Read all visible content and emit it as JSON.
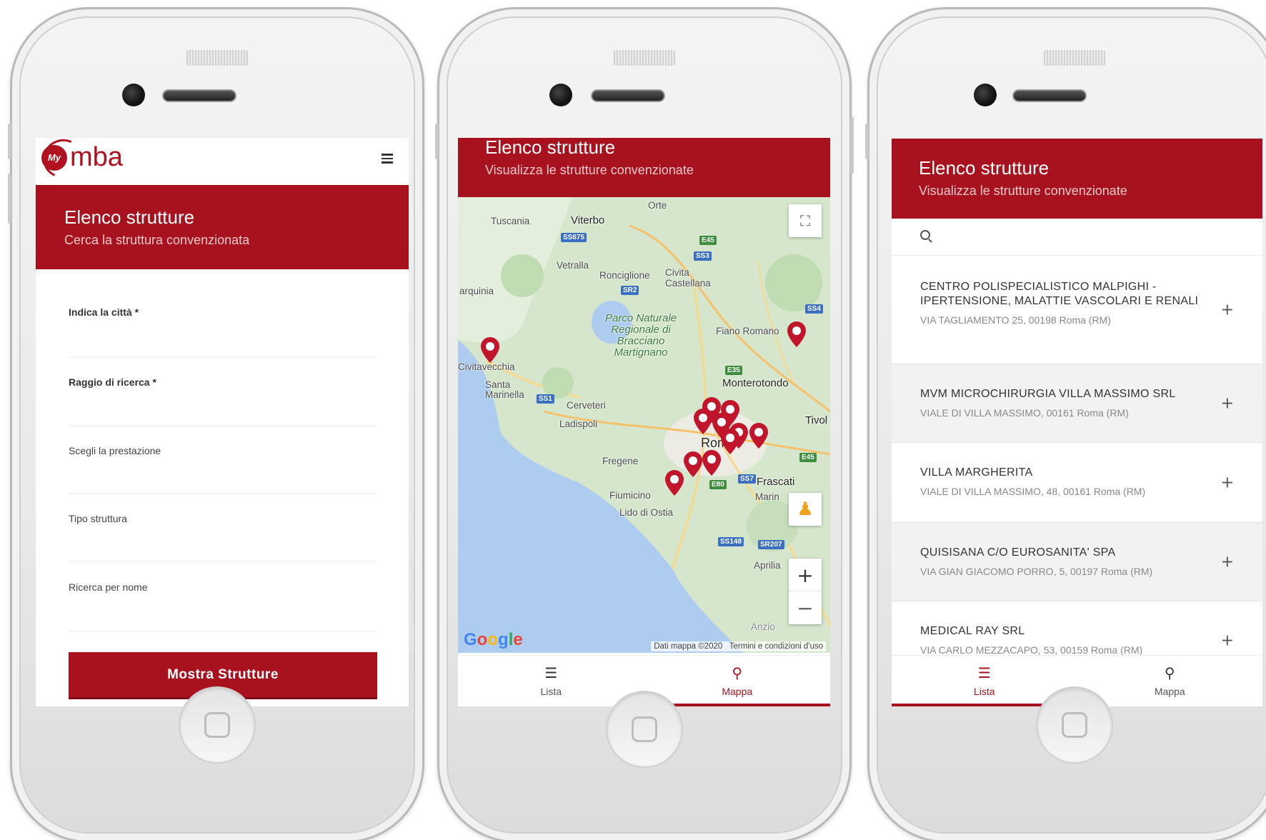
{
  "brand": {
    "logo_badge": "My",
    "logo_word": "mba",
    "accent": "#a8121e"
  },
  "search_form": {
    "title": "Elenco strutture",
    "subtitle": "Cerca la struttura convenzionata",
    "fields": {
      "city_label": "Indica la città *",
      "radius_label": "Raggio di ricerca *",
      "service_label": "Scegli la prestazione",
      "type_label": "Tipo struttura",
      "name_label": "Ricerca per nome"
    },
    "submit_label": "Mostra Strutture"
  },
  "map_view": {
    "title": "Elenco strutture",
    "subtitle": "Visualizza le strutture convenzionate",
    "places": {
      "orte": "Orte",
      "tuscania": "Tuscania",
      "viterbo": "Viterbo",
      "vetralla": "Vetralla",
      "ronciglione": "Ronciglione",
      "civita": "Civita\nCastellana",
      "tarquinia": "arquinia",
      "parco": "Parco Naturale Regionale di Bracciano Martignano",
      "fiano": "Fiano Romano",
      "civitavecchia": "Civitavecchia",
      "santa_marinella": "Santa Marinella",
      "cerveteri": "Cerveteri",
      "ladispoli": "Ladispoli",
      "monterotondo": "Monterotondo",
      "tivoli": "Tivol",
      "roma": "Rom",
      "fregene": "Fregene",
      "frascati": "Frascati",
      "fiumicino": "Fiumicino",
      "marino": "Marin",
      "lido": "Lido di Ostia",
      "aprilia": "Aprilia",
      "anzio": "Anzio"
    },
    "roads": {
      "ss675": "SS675",
      "e45a": "E45",
      "ss3": "SS3",
      "sr2": "SR2",
      "ss4": "SS4",
      "e35": "E35",
      "ss1": "SS1",
      "e45b": "E45",
      "ss7": "SS7",
      "e80": "E80",
      "ss148": "SS148",
      "sr207": "SR207"
    },
    "controls": {
      "zoom_in": "+",
      "zoom_out": "−"
    },
    "google": {
      "g1": "G",
      "o1": "o",
      "o2": "o",
      "g2": "g",
      "l": "l",
      "e": "e"
    },
    "attribution": "Dati mappa ©2020   Termini e condizioni d'uso"
  },
  "list_view": {
    "title": "Elenco strutture",
    "subtitle": "Visualizza le strutture convenzionate",
    "items": [
      {
        "name": "CENTRO POLISPECIALISTICO MALPIGHI - IPERTENSIONE, MALATTIE VASCOLARI E RENALI",
        "address": "VIA TAGLIAMENTO 25, 00198 Roma (RM)"
      },
      {
        "name": "MVM MICROCHIRURGIA VILLA MASSIMO SRL",
        "address": "VIALE DI VILLA MASSIMO, 00161 Roma (RM)"
      },
      {
        "name": "VILLA MARGHERITA",
        "address": "VIALE DI VILLA MASSIMO, 48, 00161 Roma (RM)"
      },
      {
        "name": "QUISISANA C/O EUROSANITA' SPA",
        "address": "VIA GIAN GIACOMO PORRO, 5, 00197 Roma (RM)"
      },
      {
        "name": "MEDICAL RAY SRL",
        "address": "VIA CARLO MEZZACAPO, 53, 00159 Roma (RM)"
      }
    ],
    "expand_label": "+"
  },
  "tabs": {
    "list": "Lista",
    "map": "Mappa"
  },
  "icons": {
    "list": "list-icon",
    "map": "map-marker-icon",
    "search": "search-icon",
    "menu": "hamburger-menu-icon"
  }
}
